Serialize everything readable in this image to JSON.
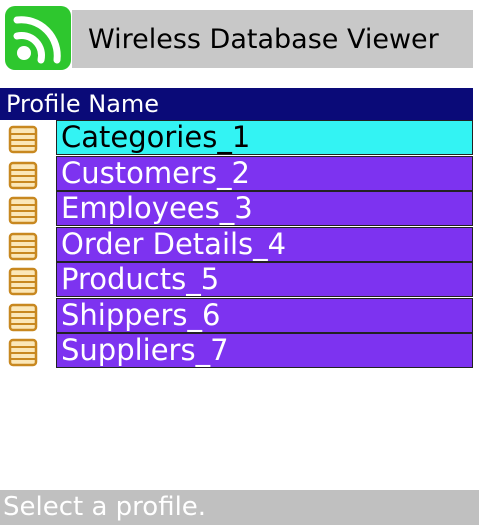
{
  "app": {
    "title": "Wireless Database Viewer",
    "icon": "wireless-signal-icon",
    "icon_color": "#2ec72e"
  },
  "list": {
    "column_header": "Profile Name",
    "items": [
      {
        "label": "Categories_1",
        "icon": "database-icon",
        "selected": true
      },
      {
        "label": "Customers_2",
        "icon": "database-icon",
        "selected": false
      },
      {
        "label": "Employees_3",
        "icon": "database-icon",
        "selected": false
      },
      {
        "label": "Order Details_4",
        "icon": "database-icon",
        "selected": false
      },
      {
        "label": "Products_5",
        "icon": "database-icon",
        "selected": false
      },
      {
        "label": "Shippers_6",
        "icon": "database-icon",
        "selected": false
      },
      {
        "label": "Suppliers_7",
        "icon": "database-icon",
        "selected": false
      }
    ],
    "selected_color": "#33f3f3",
    "item_color": "#7d33f0",
    "header_color": "#0a0a78"
  },
  "status": {
    "text": "Select a profile."
  }
}
